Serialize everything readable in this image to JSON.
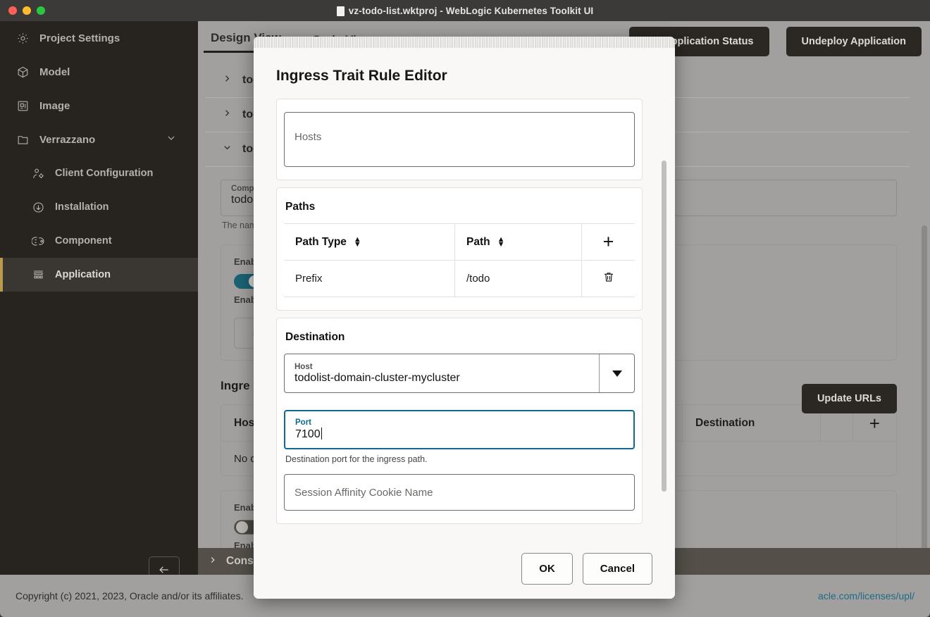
{
  "window": {
    "title": "vz-todo-list.wktproj - WebLogic Kubernetes Toolkit UI",
    "doc_icon": "document-icon"
  },
  "sidebar": {
    "items": [
      {
        "label": "Project Settings",
        "icon": "gear-icon",
        "level": 0,
        "selected": false
      },
      {
        "label": "Model",
        "icon": "cube-icon",
        "level": 0,
        "selected": false
      },
      {
        "label": "Image",
        "icon": "image-icon",
        "level": 0,
        "selected": false
      },
      {
        "label": "Verrazzano",
        "icon": "folder-icon",
        "level": 0,
        "selected": false,
        "expanded": true
      },
      {
        "label": "Client Configuration",
        "icon": "user-gear-icon",
        "level": 1,
        "selected": false
      },
      {
        "label": "Installation",
        "icon": "download-circle-icon",
        "level": 1,
        "selected": false
      },
      {
        "label": "Component",
        "icon": "component-icon",
        "level": 1,
        "selected": false
      },
      {
        "label": "Application",
        "icon": "application-icon",
        "level": 1,
        "selected": true
      }
    ],
    "back_button": "back-arrow-icon"
  },
  "main": {
    "tabs": [
      {
        "label": "Design View",
        "active": true
      },
      {
        "label": "Code View",
        "active": false
      }
    ],
    "top_actions": [
      {
        "label": "Get Application Status"
      },
      {
        "label": "Undeploy Application"
      }
    ],
    "accordions": [
      {
        "label": "tod",
        "expanded": false
      },
      {
        "label": "tod",
        "expanded": false
      },
      {
        "label": "tod",
        "expanded": true
      }
    ],
    "component_field": {
      "label": "Compo",
      "value": "todoli",
      "hint": "The nam"
    },
    "enable_toggle_1": {
      "label": "Enable",
      "sub_label": "Enable",
      "state": "on"
    },
    "secret_button": "Secr",
    "ingress_section": "Ingre",
    "ingress_table": {
      "columns": [
        "Host",
        "Destination"
      ],
      "empty_text": "No d",
      "add_icon": "plus-icon"
    },
    "update_urls_button": "Update URLs",
    "enable_toggle_2": {
      "label": "Enable",
      "sub_label": "Enable",
      "state": "off"
    },
    "console_bar": {
      "label": "Conso",
      "icon": "chevron-right-icon"
    }
  },
  "footer": {
    "copyright": "Copyright (c) 2021, 2023, Oracle and/or its affiliates. ",
    "license_link": "acle.com/licenses/upl/"
  },
  "modal": {
    "title": "Ingress Trait Rule Editor",
    "hosts": {
      "placeholder": "Hosts",
      "value": ""
    },
    "paths": {
      "title": "Paths",
      "columns": [
        {
          "label": "Path Type",
          "sortable": true
        },
        {
          "label": "Path",
          "sortable": true
        }
      ],
      "add_icon": "plus-icon",
      "rows": [
        {
          "path_type": "Prefix",
          "path": "/todo",
          "delete_icon": "trash-icon"
        }
      ]
    },
    "destination": {
      "title": "Destination",
      "host": {
        "label": "Host",
        "value": "todolist-domain-cluster-mycluster",
        "dropdown_icon": "chevron-down-icon"
      },
      "port": {
        "label": "Port",
        "value": "7100",
        "hint": "Destination port for the ingress path.",
        "focused": true
      },
      "session_affinity": {
        "placeholder": "Session Affinity Cookie Name",
        "value": ""
      }
    },
    "buttons": {
      "ok": "OK",
      "cancel": "Cancel"
    }
  },
  "colors": {
    "accent_focus": "#116b8e",
    "selected_marker": "#b89b4b",
    "toggle_on": "#1a6274",
    "link": "#1f6a86"
  }
}
